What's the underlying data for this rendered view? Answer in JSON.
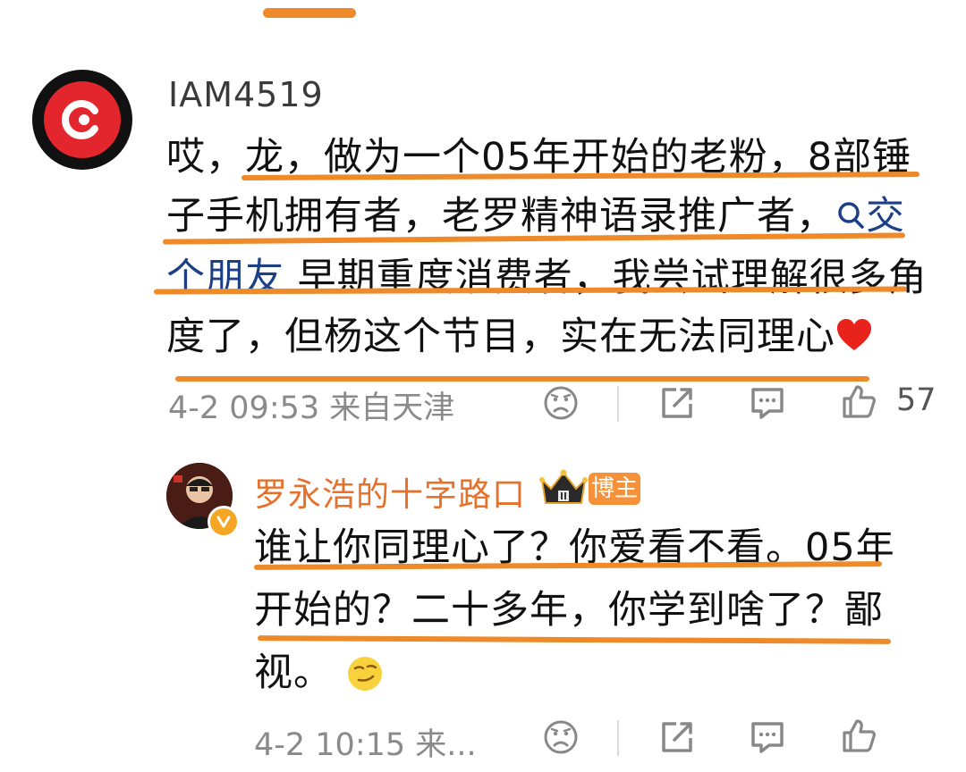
{
  "comment": {
    "username": "IAM4519",
    "text_part1": "哎，龙，做为一个05年开始的老粉，8部锤子手机拥有者，老罗精神语录推广者，",
    "search_topic": "交个朋友",
    "text_part2": " 早期重度消费者，我尝试理解很多角度了，但杨这个节目，实在无法同理心",
    "time": "4-2 09:53",
    "location": "来自天津",
    "like_count": "57"
  },
  "reply": {
    "author": "罗永浩的十字路口",
    "badge": "博主",
    "text": "谁让你同理心了？你爱看不看。05年开始的？二十多年，你学到啥了？鄙视。",
    "time": "4-2 10:15",
    "location_truncated": "来..."
  },
  "colors": {
    "accent_orange": "#ee8a2a",
    "author_orange": "#e7702a",
    "link_blue": "#1d3f86",
    "meta_gray": "#8a8a8a"
  },
  "icons": [
    "sad-face-icon",
    "share-icon",
    "comment-icon",
    "like-icon",
    "search-icon",
    "heart-icon",
    "crown-icon",
    "verified-icon",
    "smirk-emoji-icon"
  ]
}
